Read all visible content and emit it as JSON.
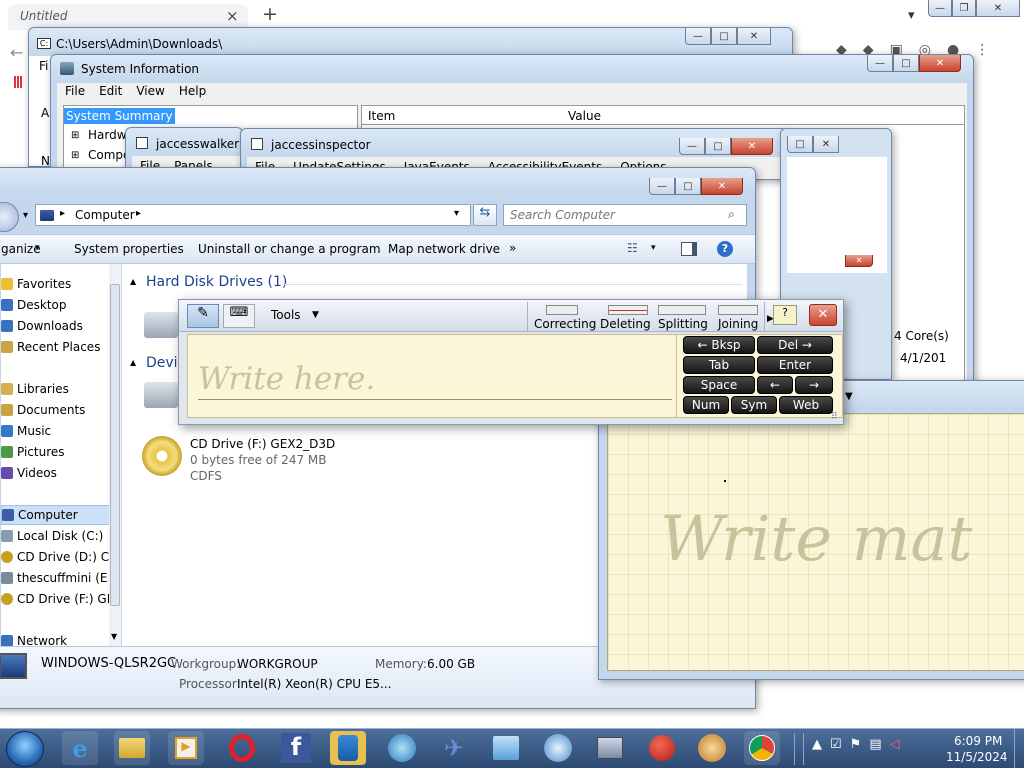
{
  "browser": {
    "tab_title": "Untitled",
    "new_tab": "+",
    "close_tab": "×",
    "chevron": "▾"
  },
  "explorer_bg": {
    "path": "C:\\Users\\Admin\\Downloads\\",
    "menu_first": "Fi",
    "side_partial_1": "A",
    "side_partial_2": "N"
  },
  "sysinfo": {
    "title": "System Information",
    "menu": [
      "File",
      "Edit",
      "View",
      "Help"
    ],
    "tree_selected": "System Summary",
    "tree_items": [
      "Hardw",
      "Compo"
    ],
    "col_item": "Item",
    "col_value": "Value",
    "val_cores": "4 Core(s)",
    "val_date": "4/1/201"
  },
  "jaccesswalker": {
    "title": "jaccesswalker",
    "menu": [
      "File",
      "Panels"
    ]
  },
  "jaccessinspector": {
    "title": "jaccessinspector",
    "menu": [
      "File",
      "UpdateSettings",
      "JavaEvents",
      "AccessibilityEvents",
      "Options"
    ]
  },
  "computer": {
    "breadcrumb": "Computer",
    "search_placeholder": "Search Computer",
    "toolbar": [
      "ganize",
      "System properties",
      "Uninstall or change a program",
      "Map network drive",
      "»"
    ],
    "favorites_header": "Favorites",
    "favorites": [
      "Desktop",
      "Downloads",
      "Recent Places"
    ],
    "libraries_header": "Libraries",
    "libraries": [
      "Documents",
      "Music",
      "Pictures",
      "Videos"
    ],
    "computer_header": "Computer",
    "drives_nav": [
      "Local Disk (C:)",
      "CD Drive (D:) CDI",
      "thescuffmini (E:)",
      "CD Drive (F:) GEX"
    ],
    "network_header": "Network",
    "hdd_group": "Hard Disk Drives (1)",
    "devices_group": "Devic",
    "cd_name": "CD Drive (F:) GEX2_D3D",
    "cd_free": "0 bytes free of 247 MB",
    "cd_fs": "CDFS",
    "status_name": "WINDOWS-QLSR2GC",
    "status_workgroup_label": "Workgroup:",
    "status_workgroup": "WORKGROUP",
    "status_memory_label": "Memory:",
    "status_memory": "6.00 GB",
    "status_processor_label": "Processor:",
    "status_processor": "Intel(R) Xeon(R) CPU E5..."
  },
  "tip": {
    "tools": "Tools",
    "gestures": [
      "Correcting",
      "Deleting",
      "Splitting",
      "Joining"
    ],
    "write_here": "Write here.",
    "keys": {
      "bksp": "← Bksp",
      "del": "Del →",
      "tab": "Tab",
      "enter": "Enter",
      "space": "Space",
      "left": "←",
      "right": "→",
      "num": "Num",
      "sym": "Sym",
      "web": "Web"
    },
    "close": "✕"
  },
  "math": {
    "write_math": "Write mat"
  },
  "taskbar": {
    "time": "6:09 PM",
    "date": "11/5/2024",
    "icons": [
      "ie-icon",
      "folder-icon",
      "media-icon",
      "opera-icon",
      "facebook-icon",
      "people-icon",
      "globe-icon",
      "bird-icon",
      "box-icon",
      "dolphin-icon",
      "network-icon",
      "apple-icon",
      "compass-icon",
      "chrome-icon"
    ]
  },
  "colors": {
    "accent_blue": "#1f3f8f",
    "selection": "#3399ff",
    "tip_bg": "#fbf6d8"
  }
}
